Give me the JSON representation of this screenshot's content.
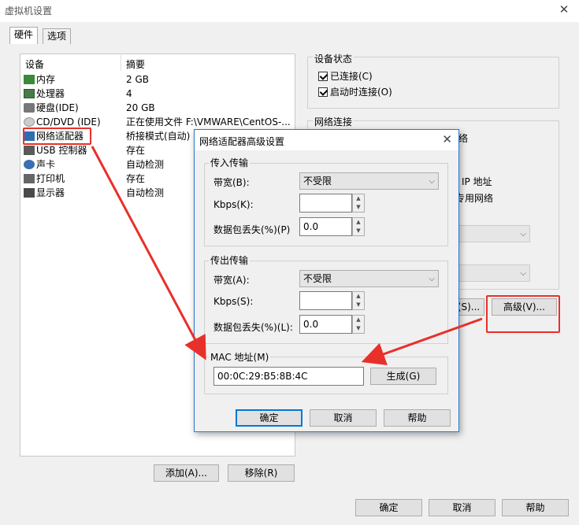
{
  "window": {
    "title": "虚拟机设置"
  },
  "tabs": [
    "硬件",
    "选项"
  ],
  "device_list": {
    "headers": [
      "设备",
      "摘要"
    ],
    "rows": [
      {
        "device": "内存",
        "summary": "2 GB"
      },
      {
        "device": "处理器",
        "summary": "4"
      },
      {
        "device": "硬盘(IDE)",
        "summary": "20 GB"
      },
      {
        "device": "CD/DVD (IDE)",
        "summary": "正在使用文件 F:\\VMWARE\\CentOS-..."
      },
      {
        "device": "网络适配器",
        "summary": "桥接模式(自动)"
      },
      {
        "device": "USB 控制器",
        "summary": "存在"
      },
      {
        "device": "声卡",
        "summary": "自动检测"
      },
      {
        "device": "打印机",
        "summary": "存在"
      },
      {
        "device": "显示器",
        "summary": "自动检测"
      }
    ],
    "add_button": "添加(A)...",
    "remove_button": "移除(R)"
  },
  "device_status": {
    "title": "设备状态",
    "connected": "已连接(C)",
    "connect_at_power_on": "启动时连接(O)"
  },
  "network": {
    "title": "网络连接",
    "partial_1": "络",
    "partial_2": "IP 地址",
    "partial_3": "专用网络",
    "segment_button": "(S)...",
    "advanced_button": "高级(V)..."
  },
  "dialog": {
    "title": "网络适配器高级设置",
    "incoming": {
      "title": "传入传输",
      "bandwidth_label": "带宽(B):",
      "bandwidth_value": "不受限",
      "kbps_label": "Kbps(K):",
      "kbps_value": "",
      "loss_label": "数据包丢失(%)(P)",
      "loss_value": "0.0"
    },
    "outgoing": {
      "title": "传出传输",
      "bandwidth_label": "带宽(A):",
      "bandwidth_value": "不受限",
      "kbps_label": "Kbps(S):",
      "kbps_value": "",
      "loss_label": "数据包丢失(%)(L):",
      "loss_value": "0.0"
    },
    "mac": {
      "title": "MAC 地址(M)",
      "value": "00:0C:29:B5:8B:4C",
      "generate_button": "生成(G)"
    },
    "ok": "确定",
    "cancel": "取消",
    "help": "帮助"
  },
  "footer": {
    "ok": "确定",
    "cancel": "取消",
    "help": "帮助"
  },
  "colors": {
    "annotation_red": "#e8302a",
    "accent_blue": "#0078d7"
  }
}
